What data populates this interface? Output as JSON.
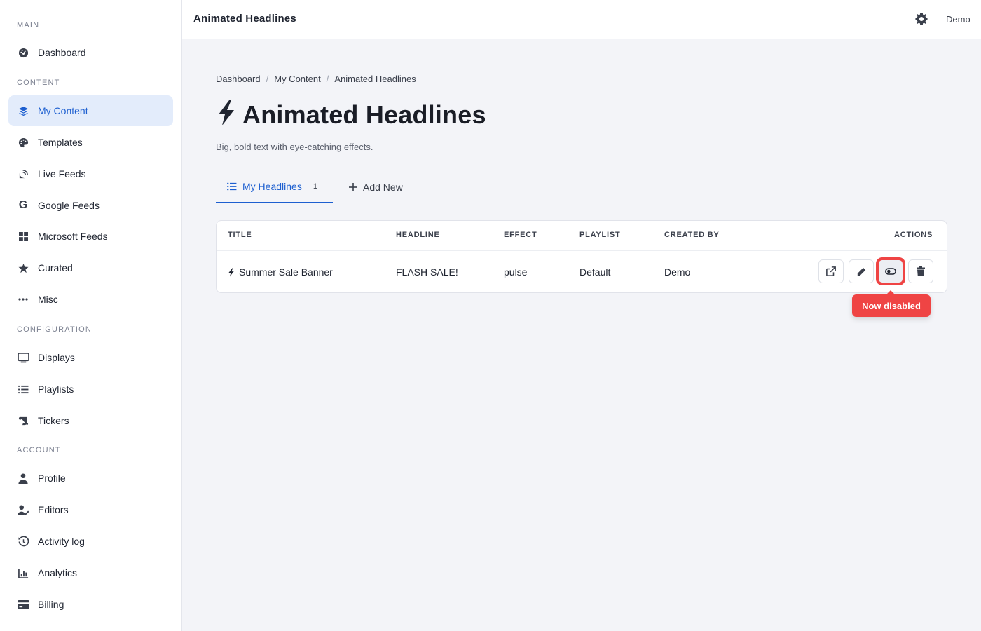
{
  "sidebar": {
    "sections": [
      {
        "label": "MAIN"
      },
      {
        "label": "CONTENT"
      },
      {
        "label": "CONFIGURATION"
      },
      {
        "label": "ACCOUNT"
      }
    ],
    "items": [
      {
        "label": "Dashboard",
        "icon": "dashboard-icon"
      },
      {
        "label": "My Content",
        "icon": "layers-icon",
        "active": true
      },
      {
        "label": "Templates",
        "icon": "palette-icon"
      },
      {
        "label": "Live Feeds",
        "icon": "satellite-dish-icon"
      },
      {
        "label": "Google Feeds",
        "icon": "google-icon"
      },
      {
        "label": "Microsoft Feeds",
        "icon": "windows-icon"
      },
      {
        "label": "Curated",
        "icon": "star-icon"
      },
      {
        "label": "Misc",
        "icon": "ellipsis-icon"
      },
      {
        "label": "Displays",
        "icon": "monitor-icon"
      },
      {
        "label": "Playlists",
        "icon": "list-icon"
      },
      {
        "label": "Tickers",
        "icon": "scroll-icon"
      },
      {
        "label": "Profile",
        "icon": "user-icon"
      },
      {
        "label": "Editors",
        "icon": "user-edit-icon"
      },
      {
        "label": "Activity log",
        "icon": "history-icon"
      },
      {
        "label": "Analytics",
        "icon": "chart-icon"
      },
      {
        "label": "Billing",
        "icon": "credit-card-icon"
      }
    ]
  },
  "topbar": {
    "title": "Animated Headlines",
    "user": "Demo"
  },
  "breadcrumb": [
    "Dashboard",
    "My Content",
    "Animated Headlines"
  ],
  "page": {
    "title": "Animated Headlines",
    "subtitle": "Big, bold text with eye-catching effects."
  },
  "tabs": {
    "my_headlines": "My Headlines",
    "count": "1",
    "add_new": "Add New"
  },
  "table": {
    "headers": [
      "TITLE",
      "HEADLINE",
      "EFFECT",
      "PLAYLIST",
      "CREATED BY",
      "ACTIONS"
    ],
    "rows": [
      {
        "title": "Summer Sale Banner",
        "headline": "FLASH SALE!",
        "effect": "pulse",
        "playlist": "Default",
        "created_by": "Demo"
      }
    ]
  },
  "tooltip": "Now disabled",
  "colors": {
    "accent": "#1d5fd0",
    "danger": "#ef4444"
  }
}
